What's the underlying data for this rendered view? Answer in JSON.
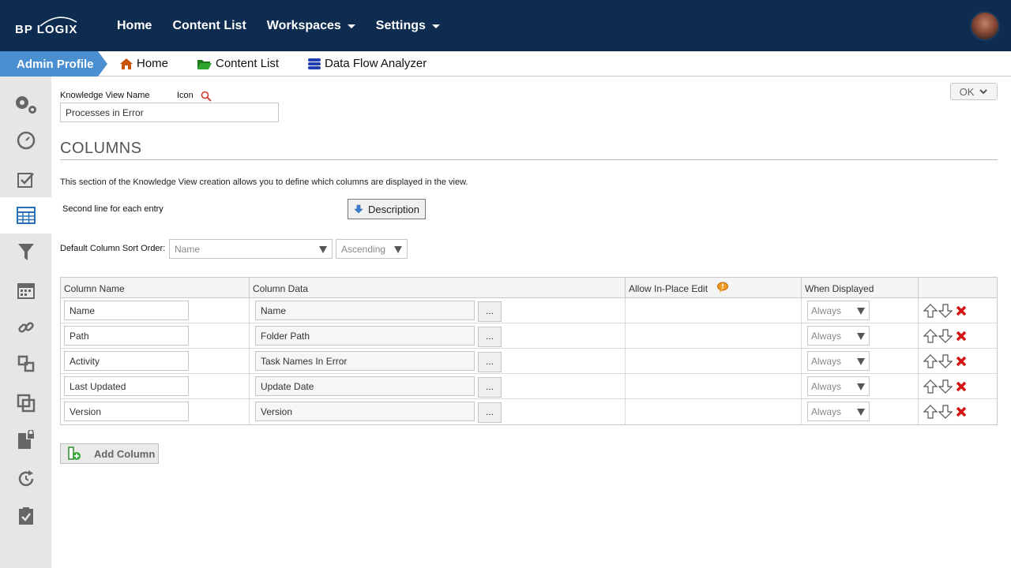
{
  "topbar": {
    "logo": "BP LOGIX",
    "nav": [
      "Home",
      "Content List",
      "Workspaces",
      "Settings"
    ]
  },
  "breadcrumb": {
    "profile": "Admin Profile",
    "items": [
      "Home",
      "Content List",
      "Data Flow Analyzer"
    ]
  },
  "sidebar": {
    "icons": [
      "gears-icon",
      "dashboard-icon",
      "checklist-icon",
      "table-icon",
      "filter-icon",
      "calendar-icon",
      "link-icon",
      "relationship-icon",
      "copy-icon",
      "locked-file-icon",
      "refresh-icon",
      "clipboard-icon"
    ]
  },
  "form": {
    "kv_name_label": "Knowledge View Name",
    "icon_label": "Icon",
    "kv_name_value": "Processes in Error",
    "ok_label": "OK",
    "section_title": "COLUMNS",
    "intro": "This section of the Knowledge View creation allows you to define which columns are displayed in the view.",
    "second_line_label": "Second line for each entry",
    "description_button": "Description",
    "sort_label": "Default Column Sort Order:",
    "sort_field": "Name",
    "sort_dir": "Ascending",
    "add_column": "Add Column"
  },
  "table": {
    "headers": [
      "Column Name",
      "Column Data",
      "Allow In-Place Edit",
      "When Displayed",
      ""
    ],
    "rows": [
      {
        "name": "Name",
        "data": "Name",
        "when": "Always"
      },
      {
        "name": "Path",
        "data": "Folder Path",
        "when": "Always"
      },
      {
        "name": "Activity",
        "data": "Task Names In Error",
        "when": "Always"
      },
      {
        "name": "Last Updated",
        "data": "Update Date",
        "when": "Always"
      },
      {
        "name": "Version",
        "data": "Version",
        "when": "Always"
      }
    ],
    "dots_label": "..."
  }
}
